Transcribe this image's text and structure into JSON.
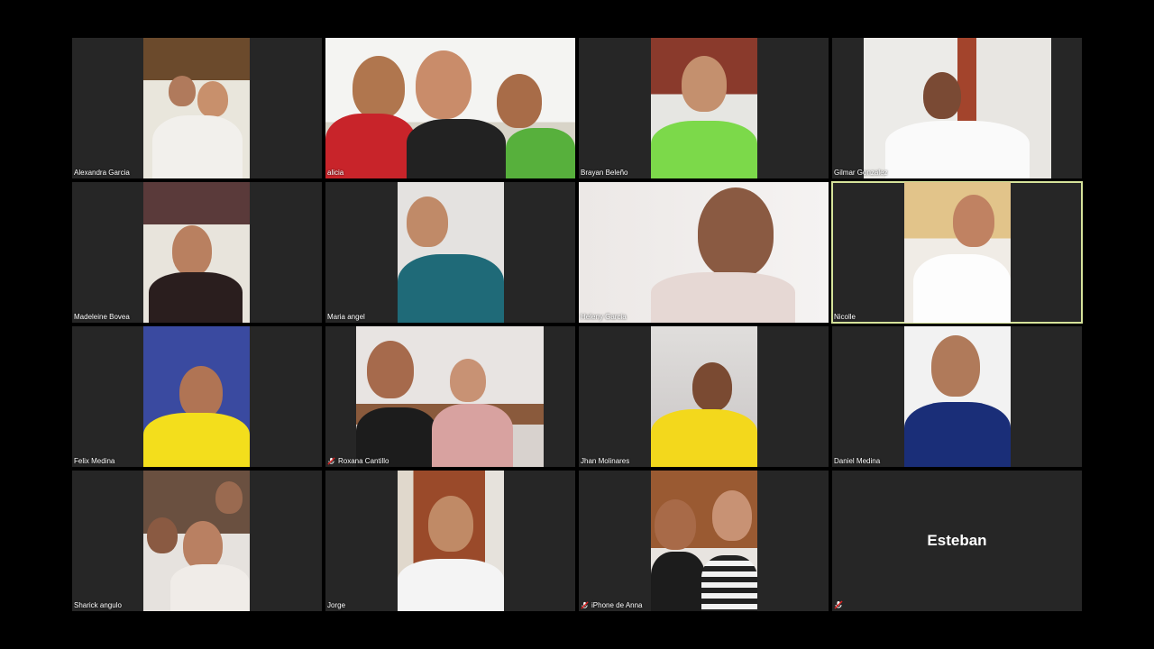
{
  "participants": [
    {
      "name": "Alexandra Garcia",
      "muted": false
    },
    {
      "name": "alicia",
      "muted": false
    },
    {
      "name": "Brayan Beleño",
      "muted": false
    },
    {
      "name": "Gilmar Gonzalez",
      "muted": false
    },
    {
      "name": "Madeleine Bovea",
      "muted": false
    },
    {
      "name": "Maria angel",
      "muted": false
    },
    {
      "name": "Heleny Garcia",
      "muted": false
    },
    {
      "name": "Nicolle",
      "muted": false,
      "active_speaker": true
    },
    {
      "name": "Felix Medina",
      "muted": false
    },
    {
      "name": "Roxana Cantillo",
      "muted": true
    },
    {
      "name": "Jhan Molinares",
      "muted": false
    },
    {
      "name": "Daniel Medina",
      "muted": false
    },
    {
      "name": "Sharick angulo",
      "muted": false
    },
    {
      "name": "Jorge",
      "muted": false
    },
    {
      "name": "iPhone de Anna",
      "muted": true
    },
    {
      "name": "Esteban",
      "muted": true,
      "video_off": true
    }
  ],
  "colors": {
    "background": "#000000",
    "tile": "#262626",
    "active_border": "#d6e39a",
    "mute_icon": "#e02020"
  }
}
